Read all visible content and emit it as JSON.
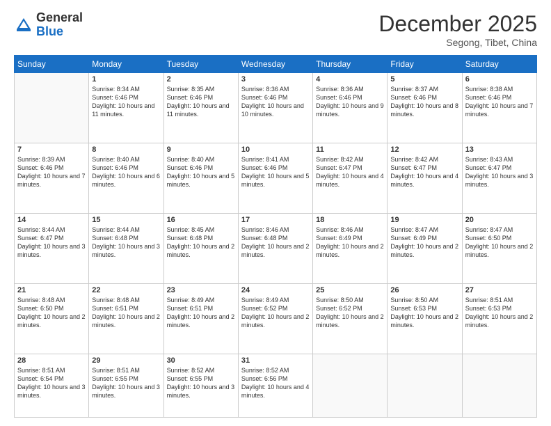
{
  "header": {
    "logo_general": "General",
    "logo_blue": "Blue",
    "month_title": "December 2025",
    "location": "Segong, Tibet, China"
  },
  "days_of_week": [
    "Sunday",
    "Monday",
    "Tuesday",
    "Wednesday",
    "Thursday",
    "Friday",
    "Saturday"
  ],
  "weeks": [
    [
      {
        "day": "",
        "sunrise": "",
        "sunset": "",
        "daylight": ""
      },
      {
        "day": "1",
        "sunrise": "Sunrise: 8:34 AM",
        "sunset": "Sunset: 6:46 PM",
        "daylight": "Daylight: 10 hours and 11 minutes."
      },
      {
        "day": "2",
        "sunrise": "Sunrise: 8:35 AM",
        "sunset": "Sunset: 6:46 PM",
        "daylight": "Daylight: 10 hours and 11 minutes."
      },
      {
        "day": "3",
        "sunrise": "Sunrise: 8:36 AM",
        "sunset": "Sunset: 6:46 PM",
        "daylight": "Daylight: 10 hours and 10 minutes."
      },
      {
        "day": "4",
        "sunrise": "Sunrise: 8:36 AM",
        "sunset": "Sunset: 6:46 PM",
        "daylight": "Daylight: 10 hours and 9 minutes."
      },
      {
        "day": "5",
        "sunrise": "Sunrise: 8:37 AM",
        "sunset": "Sunset: 6:46 PM",
        "daylight": "Daylight: 10 hours and 8 minutes."
      },
      {
        "day": "6",
        "sunrise": "Sunrise: 8:38 AM",
        "sunset": "Sunset: 6:46 PM",
        "daylight": "Daylight: 10 hours and 7 minutes."
      }
    ],
    [
      {
        "day": "7",
        "sunrise": "Sunrise: 8:39 AM",
        "sunset": "Sunset: 6:46 PM",
        "daylight": "Daylight: 10 hours and 7 minutes."
      },
      {
        "day": "8",
        "sunrise": "Sunrise: 8:40 AM",
        "sunset": "Sunset: 6:46 PM",
        "daylight": "Daylight: 10 hours and 6 minutes."
      },
      {
        "day": "9",
        "sunrise": "Sunrise: 8:40 AM",
        "sunset": "Sunset: 6:46 PM",
        "daylight": "Daylight: 10 hours and 5 minutes."
      },
      {
        "day": "10",
        "sunrise": "Sunrise: 8:41 AM",
        "sunset": "Sunset: 6:46 PM",
        "daylight": "Daylight: 10 hours and 5 minutes."
      },
      {
        "day": "11",
        "sunrise": "Sunrise: 8:42 AM",
        "sunset": "Sunset: 6:47 PM",
        "daylight": "Daylight: 10 hours and 4 minutes."
      },
      {
        "day": "12",
        "sunrise": "Sunrise: 8:42 AM",
        "sunset": "Sunset: 6:47 PM",
        "daylight": "Daylight: 10 hours and 4 minutes."
      },
      {
        "day": "13",
        "sunrise": "Sunrise: 8:43 AM",
        "sunset": "Sunset: 6:47 PM",
        "daylight": "Daylight: 10 hours and 3 minutes."
      }
    ],
    [
      {
        "day": "14",
        "sunrise": "Sunrise: 8:44 AM",
        "sunset": "Sunset: 6:47 PM",
        "daylight": "Daylight: 10 hours and 3 minutes."
      },
      {
        "day": "15",
        "sunrise": "Sunrise: 8:44 AM",
        "sunset": "Sunset: 6:48 PM",
        "daylight": "Daylight: 10 hours and 3 minutes."
      },
      {
        "day": "16",
        "sunrise": "Sunrise: 8:45 AM",
        "sunset": "Sunset: 6:48 PM",
        "daylight": "Daylight: 10 hours and 2 minutes."
      },
      {
        "day": "17",
        "sunrise": "Sunrise: 8:46 AM",
        "sunset": "Sunset: 6:48 PM",
        "daylight": "Daylight: 10 hours and 2 minutes."
      },
      {
        "day": "18",
        "sunrise": "Sunrise: 8:46 AM",
        "sunset": "Sunset: 6:49 PM",
        "daylight": "Daylight: 10 hours and 2 minutes."
      },
      {
        "day": "19",
        "sunrise": "Sunrise: 8:47 AM",
        "sunset": "Sunset: 6:49 PM",
        "daylight": "Daylight: 10 hours and 2 minutes."
      },
      {
        "day": "20",
        "sunrise": "Sunrise: 8:47 AM",
        "sunset": "Sunset: 6:50 PM",
        "daylight": "Daylight: 10 hours and 2 minutes."
      }
    ],
    [
      {
        "day": "21",
        "sunrise": "Sunrise: 8:48 AM",
        "sunset": "Sunset: 6:50 PM",
        "daylight": "Daylight: 10 hours and 2 minutes."
      },
      {
        "day": "22",
        "sunrise": "Sunrise: 8:48 AM",
        "sunset": "Sunset: 6:51 PM",
        "daylight": "Daylight: 10 hours and 2 minutes."
      },
      {
        "day": "23",
        "sunrise": "Sunrise: 8:49 AM",
        "sunset": "Sunset: 6:51 PM",
        "daylight": "Daylight: 10 hours and 2 minutes."
      },
      {
        "day": "24",
        "sunrise": "Sunrise: 8:49 AM",
        "sunset": "Sunset: 6:52 PM",
        "daylight": "Daylight: 10 hours and 2 minutes."
      },
      {
        "day": "25",
        "sunrise": "Sunrise: 8:50 AM",
        "sunset": "Sunset: 6:52 PM",
        "daylight": "Daylight: 10 hours and 2 minutes."
      },
      {
        "day": "26",
        "sunrise": "Sunrise: 8:50 AM",
        "sunset": "Sunset: 6:53 PM",
        "daylight": "Daylight: 10 hours and 2 minutes."
      },
      {
        "day": "27",
        "sunrise": "Sunrise: 8:51 AM",
        "sunset": "Sunset: 6:53 PM",
        "daylight": "Daylight: 10 hours and 2 minutes."
      }
    ],
    [
      {
        "day": "28",
        "sunrise": "Sunrise: 8:51 AM",
        "sunset": "Sunset: 6:54 PM",
        "daylight": "Daylight: 10 hours and 3 minutes."
      },
      {
        "day": "29",
        "sunrise": "Sunrise: 8:51 AM",
        "sunset": "Sunset: 6:55 PM",
        "daylight": "Daylight: 10 hours and 3 minutes."
      },
      {
        "day": "30",
        "sunrise": "Sunrise: 8:52 AM",
        "sunset": "Sunset: 6:55 PM",
        "daylight": "Daylight: 10 hours and 3 minutes."
      },
      {
        "day": "31",
        "sunrise": "Sunrise: 8:52 AM",
        "sunset": "Sunset: 6:56 PM",
        "daylight": "Daylight: 10 hours and 4 minutes."
      },
      {
        "day": "",
        "sunrise": "",
        "sunset": "",
        "daylight": ""
      },
      {
        "day": "",
        "sunrise": "",
        "sunset": "",
        "daylight": ""
      },
      {
        "day": "",
        "sunrise": "",
        "sunset": "",
        "daylight": ""
      }
    ]
  ]
}
